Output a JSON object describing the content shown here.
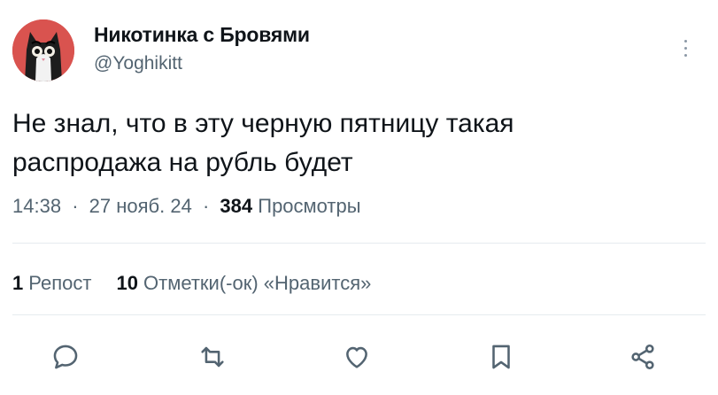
{
  "author": {
    "display_name": "Никотинка с Бровями",
    "handle": "@Yoghikitt",
    "avatar_icon": "cat-avatar-icon"
  },
  "tweet": {
    "text_line_1": "Не знал, что в эту черную пятницу такая",
    "text_line_2": "распродажа на рубль будет"
  },
  "meta": {
    "time": "14:38",
    "separator": "·",
    "date": "27 нояб. 24",
    "views_count": "384",
    "views_label": "Просмотры"
  },
  "stats": {
    "reposts_count": "1",
    "reposts_label": "Репост",
    "likes_count": "10",
    "likes_label": "Отметки(-ок) «Нравится»"
  },
  "actions": [
    "reply-icon",
    "repost-icon",
    "like-icon",
    "bookmark-icon",
    "share-icon"
  ],
  "colors": {
    "text": "#0f1419",
    "secondary": "#536471",
    "divider": "#e6ebef",
    "avatar_bg": "#d9534f"
  }
}
